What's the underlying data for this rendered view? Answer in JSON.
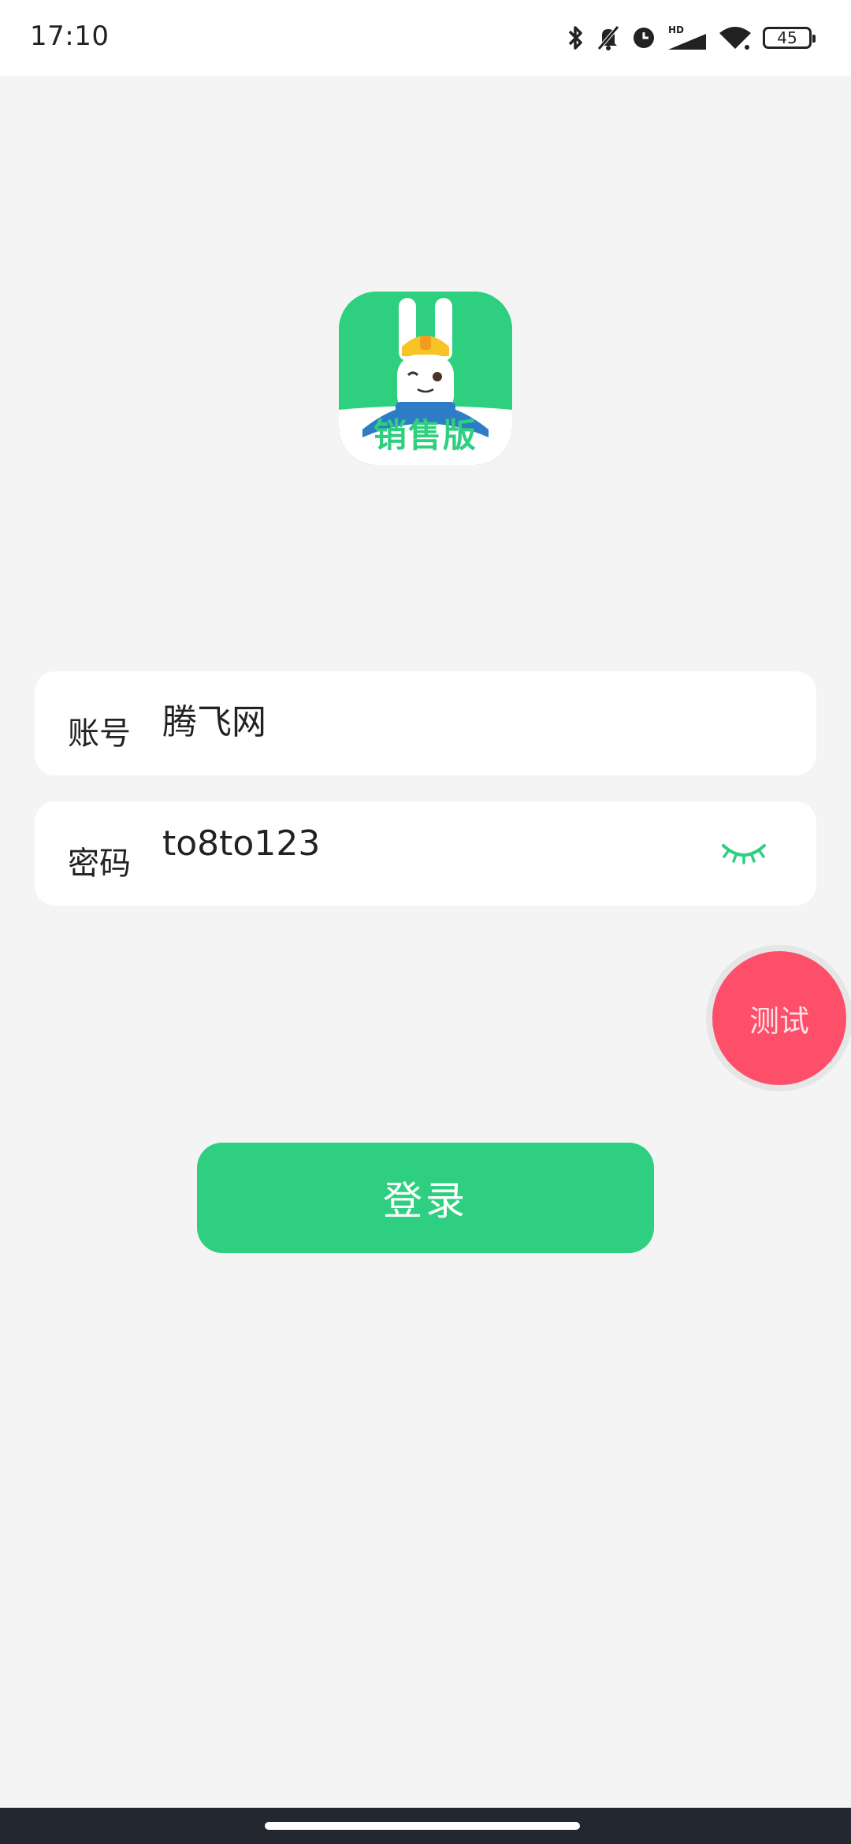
{
  "status_bar": {
    "time": "17:10",
    "battery_level": "45",
    "network_type": "HD",
    "icons": [
      "bluetooth-icon",
      "mute-bell-icon",
      "alarm-icon",
      "cell-signal-icon",
      "wifi-icon",
      "battery-icon"
    ]
  },
  "app": {
    "logo_text": "销售版",
    "brand_color": "#2ecf7e"
  },
  "login_form": {
    "account_label": "账号",
    "account_value": "腾飞网",
    "password_label": "密码",
    "password_value": "to8to123",
    "eye_icon": "eye-closed-icon",
    "login_label": "登录",
    "login_color": "#2ecf80"
  },
  "test_button": {
    "label": "测试",
    "color": "#fe4f6a"
  }
}
